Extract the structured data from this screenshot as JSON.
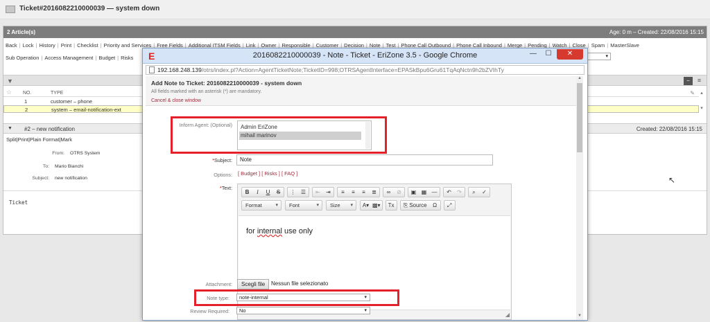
{
  "page": {
    "title": "Ticket#2016082210000039 — system down"
  },
  "article_panel": {
    "header_left": "2 Article(s)",
    "header_right": "Age: 0 m – Created: 22/08/2016 15:15",
    "menu_row1": [
      "Back",
      "Lock",
      "History",
      "Print",
      "Checklist",
      "Priority and Services",
      "Free Fields",
      "Additional ITSM Fields",
      "Link",
      "Owner",
      "Responsible",
      "Customer",
      "Decision",
      "Note",
      "Test",
      "Phone Call Outbound",
      "Phone Call Inbound",
      "Merge",
      "Pending",
      "Watch",
      "Close",
      "Spam",
      "MasterSlave"
    ],
    "menu_row2": [
      "Sub Operation",
      "Access Management",
      "Budget",
      "Risks"
    ],
    "columns": {
      "no": "NO.",
      "type": "TYPE"
    },
    "rows": [
      {
        "no": "1",
        "type": "customer – phone"
      },
      {
        "no": "2",
        "type": "system – email-notification-ext"
      }
    ],
    "notification": {
      "title": "#2 – new notification",
      "created": "Created: 22/08/2016 15:15",
      "actions": [
        "Split",
        "Print",
        "Plain Format",
        "Mark"
      ],
      "from_label": "From:",
      "from_value": "OTRS System",
      "to_label": "To:",
      "to_value": "Mario Bianchi",
      "subject_label": "Subject:",
      "subject_value": "new notification",
      "body": "Ticket"
    }
  },
  "popup": {
    "window_title": "2016082210000039 - Note - Ticket - EriZone 3.5 - Google Chrome",
    "logo": "E",
    "url_host": "192.168.248.139",
    "url_path": "/otrs/index.pl?Action=AgentTicketNote;TicketID=998;OTRSAgentInterface=EPASkBpu6Gru61TqAqNctn9h2bZVIhTy",
    "heading": "Add Note to Ticket: 2016082210000039 - system down",
    "mandatory_note": "All fields marked with an asterisk (*) are mandatory.",
    "cancel_link": "Cancel & close window",
    "inform_agent_label": "Inform Agent: (Optional)",
    "inform_agent_options": [
      "Admin EriZone",
      "mihail marinov"
    ],
    "inform_agent_selected": "mihail marinov",
    "subject_label": "Subject:",
    "subject_value": "Note",
    "options_label": "Options:",
    "options_links": [
      "[ Budget ]",
      "[ Risks ]",
      "[ FAQ ]"
    ],
    "text_label": "Text:",
    "editor": {
      "format_combo": "Format",
      "font_combo": "Font",
      "size_combo": "Size",
      "source_label": "Source",
      "content_prefix": "for ",
      "content_word": "internal",
      "content_suffix": " use only"
    },
    "attachment_label": "Attachment:",
    "choose_file_button": "Scegli file",
    "no_file_text": "Nessun file selezionato",
    "note_type_label": "Note type:",
    "note_type_value": "note-internal",
    "review_label": "Review Required:",
    "review_value": "No"
  },
  "colors": {
    "highlight_box": "#e4202a",
    "link_red": "#a3283a",
    "header_gray": "#7d7d7d"
  },
  "icons": [
    "ticket-icon",
    "filter-icon",
    "star-icon",
    "paperclip-icon",
    "erizone-logo-icon",
    "minimize-icon",
    "maximize-icon",
    "close-icon",
    "page-icon",
    "cursor-icon"
  ]
}
